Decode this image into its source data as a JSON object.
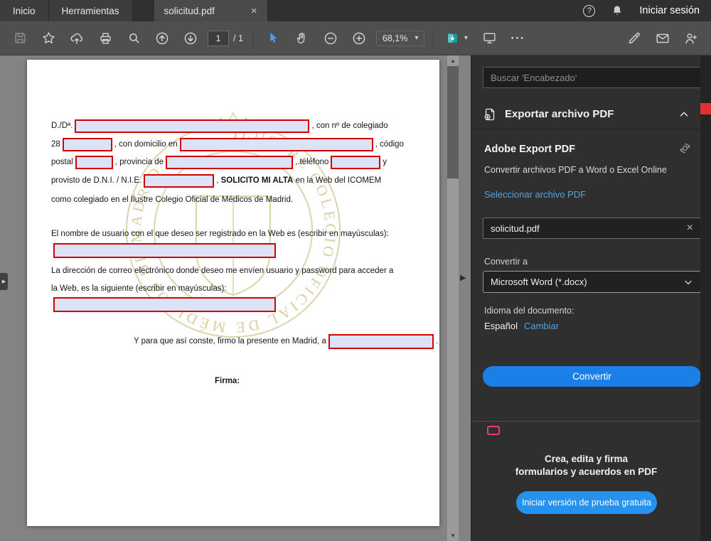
{
  "tabbar": {
    "home": "Inicio",
    "tools": "Herramientas",
    "doc_tab": "solicitud.pdf",
    "sign_in": "Iniciar sesión"
  },
  "toolbar": {
    "page_value": "1",
    "page_total": "/ 1",
    "zoom_value": "68,1%"
  },
  "doc": {
    "l1a": "D./Dª.",
    "l1b": ", con nº de colegiado",
    "l2a": "28",
    "l2b": ", con domicilio en",
    "l2c": ", código",
    "l3a": "postal",
    "l3b": ", provincia de",
    "l3c": ", teléfono",
    "l3d": "y",
    "l4a": "provisto de D.N.I. / N.I.E.",
    "l4b": ", ",
    "l4bold": "SOLICITO MI ALTA",
    "l4c": " en la Web del ICOMEM",
    "l5": "como colegiado en el Ilustre Colegio Oficial de Médicos de Madrid.",
    "l6": "El nombre de usuario con el que deseo ser registrado en la Web es (escribir en mayúsculas):",
    "l7": "La dirección de correo electrónico donde deseo me envíen usuario y password para acceder a",
    "l8": "la Web, es la siguiente (escribir en mayúsculas):",
    "l9a": "Y para que así conste, firmo la presente en Madrid, a",
    "l9b": ".",
    "firma": "Firma:",
    "watermark_text": "ILUSTRE COLEGIO OFICIAL DE MÉDICOS DE MADRID"
  },
  "panel": {
    "search_placeholder": "Buscar 'Encabezado'",
    "section_title": "Exportar archivo PDF",
    "export_title": "Adobe Export PDF",
    "export_desc": "Convertir archivos PDF a Word o Excel Online",
    "select_file_link": "Seleccionar archivo PDF",
    "file_name": "solicitud.pdf",
    "convert_to_label": "Convertir a",
    "format_value": "Microsoft Word (*.docx)",
    "language_label": "Idioma del documento:",
    "language_value": "Español",
    "change_link": "Cambiar",
    "convert_button": "Convertir",
    "promo_line1": "Crea, edita y firma",
    "promo_line2": "formularios y acuerdos en PDF",
    "trial_button": "Iniciar versión de prueba gratuita"
  },
  "glyphs": {
    "close": "×",
    "clear": "×",
    "caret": "▾",
    "more": "···",
    "help": "?",
    "tri_right": "▶",
    "tri_up": "▲",
    "tri_down": "▼"
  },
  "colors": {
    "accent_blue": "#1b7fe8",
    "trial_blue": "#2492ee",
    "link_blue": "#53a4de",
    "field_border": "#d40000",
    "field_fill": "#dde3f6",
    "scroll_red": "#e03131"
  }
}
